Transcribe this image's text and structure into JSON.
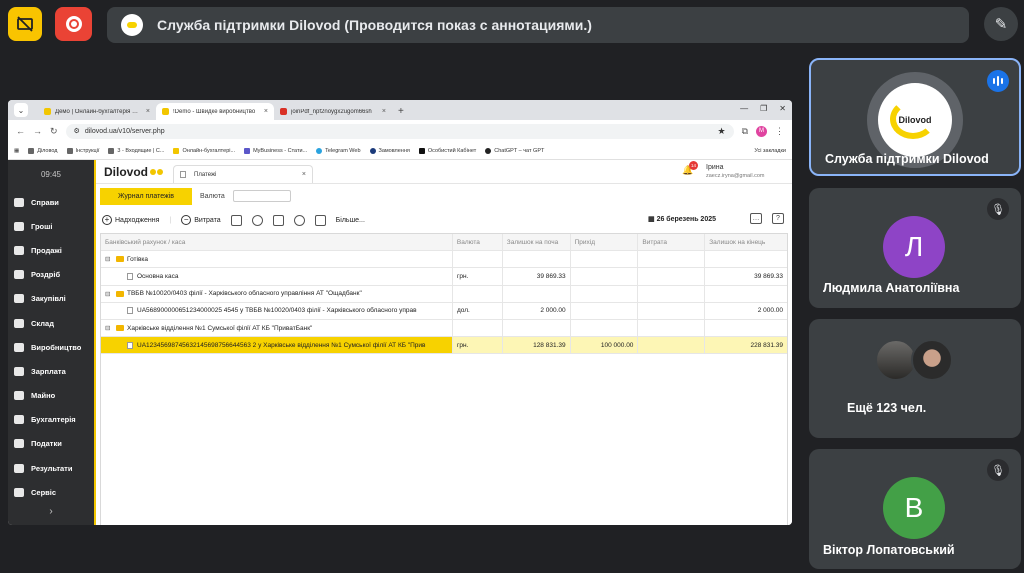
{
  "meet": {
    "share_title": "Служба підтримки Dilovod (Проводится показ с аннотациями.)"
  },
  "browser": {
    "tabs": [
      {
        "label": "Демо | Онлайн-бухгалтерія Dilovod",
        "favicon_color": "#f2c600"
      },
      {
        "label": "!Demo - Швидке виробництво",
        "favicon_color": "#f2c600"
      },
      {
        "label": "joinPdf_npf2noygx2ugom66sh",
        "favicon_color": "#d93025"
      }
    ],
    "url": "dilovod.ua/v10/server.php",
    "bookmarks": [
      "Діловод",
      "Інструкції",
      "3 - Входящие | C...",
      "Онлайн-бухгалтері...",
      "MyBusiness - Стати...",
      "Telegram Web",
      "Замовлення",
      "Особистий Кабінет",
      "ChatGPT – чат GPT"
    ],
    "bookmarks_all": "Усі закладки"
  },
  "app": {
    "logo": "Dilovod",
    "time": "09:45",
    "doc_tab": "Платежі",
    "notif_count": "14",
    "user_name": "Ірина",
    "user_email": "zaecz.iryna@gmail.com",
    "nav": [
      "Справи",
      "Гроші",
      "Продажі",
      "Роздріб",
      "Закупівлі",
      "Склад",
      "Виробництво",
      "Зарплата",
      "Майно",
      "Бухгалтерія",
      "Податки",
      "Результати",
      "Сервіс"
    ],
    "subtab_active": "Журнал платежів",
    "subtab_currency": "Валюта",
    "toolbar": {
      "income": "Надходження",
      "expense": "Витрата",
      "more": "Більше...",
      "date": "26 березень 2025"
    },
    "grid": {
      "headers": [
        "Банківський рахунок / каса",
        "Валюта",
        "Залишок на поча",
        "Прихід",
        "Витрата",
        "Залишок на кінець"
      ],
      "rows": [
        {
          "type": "group",
          "name": "Готівка",
          "cur": "",
          "start": "",
          "in": "",
          "out": "",
          "end": ""
        },
        {
          "type": "item",
          "name": "Основна каса",
          "cur": "грн.",
          "start": "39 869.33",
          "in": "",
          "out": "",
          "end": "39 869.33"
        },
        {
          "type": "group",
          "name": "ТВБВ №10020/0403 філії - Харківського обласного управління АТ \"Ощадбанк\"",
          "cur": "",
          "start": "",
          "in": "",
          "out": "",
          "end": ""
        },
        {
          "type": "item",
          "name": "UA568900000651234000025 4545 у ТВБВ №10020/0403 філії - Харківського обласного управ",
          "cur": "дол.",
          "start": "2 000.00",
          "in": "",
          "out": "",
          "end": "2 000.00"
        },
        {
          "type": "group",
          "name": "Харківське відділення №1 Сумської філії АТ КБ \"ПриватБанк\"",
          "cur": "",
          "start": "",
          "in": "",
          "out": "",
          "end": ""
        },
        {
          "type": "item-hl",
          "name": "UA12345698745632145698756644563 2 у Харківське відділення №1 Сумської філії АТ КБ \"Прив",
          "cur": "грн.",
          "start": "128 831.39",
          "in": "100 000.00",
          "out": "",
          "end": "228 831.39"
        }
      ]
    }
  },
  "participants": {
    "host": {
      "name": "Служба підтримки Dilovod",
      "logo_text": "Dilovod"
    },
    "p1": {
      "name": "Людмила Анатоліївна",
      "initial": "Л",
      "color": "#8e44c6"
    },
    "more": {
      "label": "Ещё 123 чел."
    },
    "p2": {
      "name": "Віктор Лопатовський",
      "initial": "В",
      "color": "#43a047"
    }
  }
}
